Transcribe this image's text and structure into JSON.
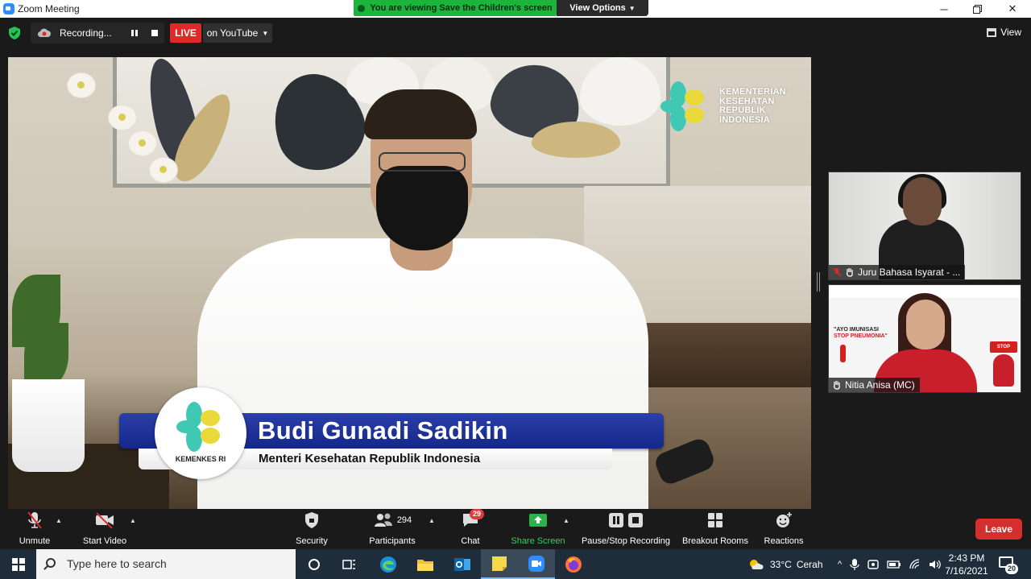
{
  "window": {
    "title": "Zoom Meeting"
  },
  "share_banner": {
    "text": "You are viewing Save the Children's screen"
  },
  "view_options": {
    "label": "View Options"
  },
  "meeting_bar": {
    "recording_label": "Recording...",
    "live_label": "LIVE",
    "stream_label": "on YouTube",
    "view_label": "View"
  },
  "shared_screen": {
    "org_lines": [
      "KEMENTERIAN",
      "KESEHATAN",
      "REPUBLIK",
      "INDONESIA"
    ],
    "badge_label": "KEMENKES RI",
    "speaker_name": "Budi Gunadi Sadikin",
    "speaker_role": "Menteri Kesehatan Republik Indonesia"
  },
  "participants_tiles": [
    {
      "name": "Juru Bahasa Isyarat - ...",
      "muted": true
    },
    {
      "name": "Nitia Anisa (MC)",
      "muted": false,
      "slide_text": [
        "\"AYO IMUNISASI",
        "STOP PNEUMONIA\""
      ],
      "stop_label": "STOP"
    }
  ],
  "toolbar": {
    "unmute": "Unmute",
    "start_video": "Start Video",
    "security": "Security",
    "participants": "Participants",
    "participants_count": "294",
    "chat": "Chat",
    "chat_badge": "29",
    "share_screen": "Share Screen",
    "recording": "Pause/Stop Recording",
    "breakout": "Breakout Rooms",
    "reactions": "Reactions",
    "leave": "Leave"
  },
  "taskbar": {
    "search_placeholder": "Type here to search",
    "weather_temp": "33°C",
    "weather_desc": "Cerah",
    "time": "2:43 PM",
    "date": "7/16/2021",
    "notifications_count": "20"
  },
  "colors": {
    "accent_green": "#1bb53b",
    "live_red": "#e02828",
    "leave_red": "#d32f2f",
    "lower_third_blue": "#1e33a0",
    "kemenkes_teal": "#3fc8b4",
    "kemenkes_yellow": "#e9d93a"
  }
}
